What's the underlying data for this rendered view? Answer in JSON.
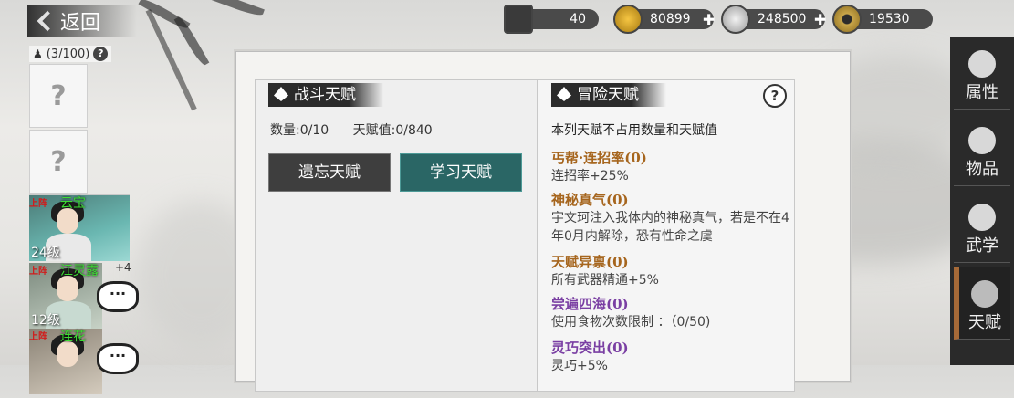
{
  "header": {
    "back_label": "返回",
    "party_count": "(3/100)"
  },
  "resources": [
    {
      "icon": "cart-icon",
      "value": "40",
      "has_plus": false
    },
    {
      "icon": "gold-ingot-icon",
      "value": "80899",
      "has_plus": true
    },
    {
      "icon": "silver-ingot-icon",
      "value": "248500",
      "has_plus": true
    },
    {
      "icon": "coin-icon",
      "value": "19530",
      "has_plus": false
    }
  ],
  "party": {
    "empty_slot_mark": "?",
    "members": [
      {
        "tag": "上阵",
        "name": "云宝",
        "level": "24级",
        "plus": ""
      },
      {
        "tag": "上阵",
        "name": "江灵露",
        "level": "12级",
        "plus": "+4"
      },
      {
        "tag": "上阵",
        "name": "连花",
        "level": "",
        "plus": ""
      }
    ]
  },
  "combat": {
    "title": "战斗天赋",
    "count_label": "数量:0/10",
    "value_label": "天赋值:0/840",
    "forget_button": "遗忘天赋",
    "learn_button": "学习天赋"
  },
  "adventure": {
    "title": "冒险天赋",
    "note": "本列天赋不占用数量和天赋值",
    "talents": [
      {
        "name": "丐帮·连招率(0)",
        "desc": "连招率+25%",
        "color": "#a6651d"
      },
      {
        "name": "神秘真气(0)",
        "desc": "宇文珂注入我体内的神秘真气，若是不在4年0月内解除，恐有性命之虞",
        "color": "#a6651d"
      },
      {
        "name": "天赋异禀(0)",
        "desc": "所有武器精通+5%",
        "color": "#a6651d"
      },
      {
        "name": "尝遍四海(0)",
        "desc": "使用食物次数限制 ：（0/50)",
        "color": "#7a3fa3"
      },
      {
        "name": "灵巧突出(0)",
        "desc": "灵巧+5%",
        "color": "#7a3fa3"
      }
    ]
  },
  "side_tabs": [
    {
      "label": "属性",
      "icon": "attribute-icon"
    },
    {
      "label": "物品",
      "icon": "item-icon"
    },
    {
      "label": "武学",
      "icon": "martial-book-icon"
    },
    {
      "label": "天赋",
      "icon": "talent-icon",
      "active": true
    }
  ]
}
